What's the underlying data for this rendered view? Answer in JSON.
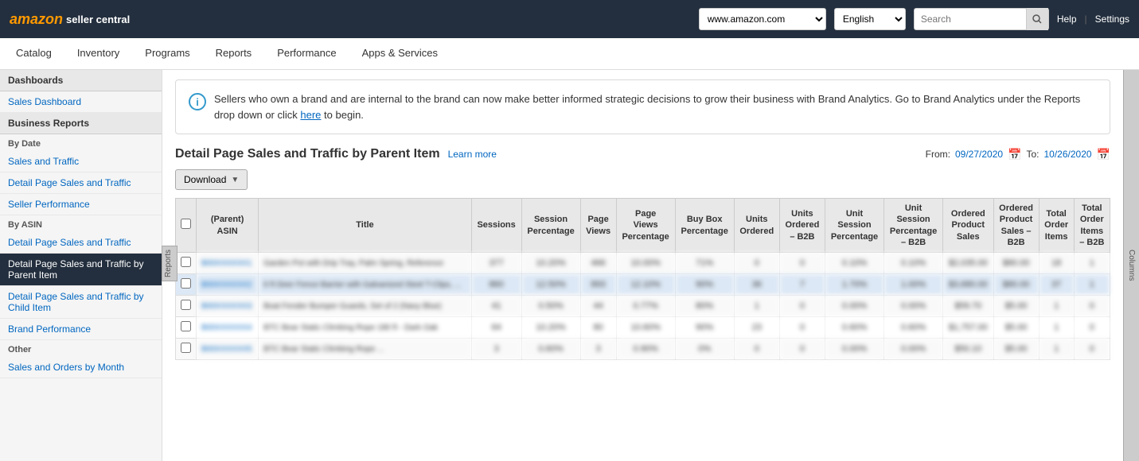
{
  "header": {
    "logo_brand": "amazon",
    "logo_service": "seller central",
    "domain": "www.amazon.com",
    "language": "English",
    "search_placeholder": "Search",
    "help_label": "Help",
    "settings_label": "Settings"
  },
  "navbar": {
    "items": [
      {
        "label": "Catalog"
      },
      {
        "label": "Inventory"
      },
      {
        "label": "Programs"
      },
      {
        "label": "Reports"
      },
      {
        "label": "Performance"
      },
      {
        "label": "Apps & Services"
      }
    ]
  },
  "sidebar": {
    "dashboards_header": "Dashboards",
    "sales_dashboard": "Sales Dashboard",
    "business_reports_header": "Business Reports",
    "by_date_label": "By Date",
    "items_by_date": [
      {
        "label": "Sales and Traffic"
      },
      {
        "label": "Detail Page Sales and Traffic"
      },
      {
        "label": "Seller Performance"
      }
    ],
    "by_asin_label": "By ASIN",
    "items_by_asin": [
      {
        "label": "Detail Page Sales and Traffic"
      },
      {
        "label": "Detail Page Sales and Traffic by Parent Item",
        "active": true
      },
      {
        "label": "Detail Page Sales and Traffic by Child Item"
      },
      {
        "label": "Brand Performance"
      }
    ],
    "other_label": "Other",
    "items_other": [
      {
        "label": "Sales and Orders by Month"
      }
    ],
    "reports_side_label": "Reports",
    "columns_side_label": "Columns"
  },
  "info_banner": {
    "text_before_link": "Sellers who own a brand and are internal to the brand can now make better informed strategic decisions to grow their business with Brand Analytics. Go to Brand Analytics under the Reports drop down or click ",
    "link_text": "here",
    "text_after_link": " to begin."
  },
  "table_section": {
    "title": "Detail Page Sales and Traffic by Parent Item",
    "learn_more": "Learn more",
    "from_label": "From:",
    "from_date": "09/27/2020",
    "to_label": "To:",
    "to_date": "10/26/2020",
    "download_label": "Download",
    "columns": [
      {
        "label": "(Parent)\nASIN",
        "key": "asin"
      },
      {
        "label": "Title",
        "key": "title"
      },
      {
        "label": "Sessions",
        "key": "sessions"
      },
      {
        "label": "Session\nPercentage",
        "key": "session_pct"
      },
      {
        "label": "Page\nViews",
        "key": "page_views"
      },
      {
        "label": "Page\nViews\nPercentage",
        "key": "page_views_pct"
      },
      {
        "label": "Buy Box\nPercentage",
        "key": "buy_box_pct"
      },
      {
        "label": "Units\nOrdered",
        "key": "units_ordered"
      },
      {
        "label": "Units\nOrdered\n– B2B",
        "key": "units_b2b"
      },
      {
        "label": "Unit\nSession\nPercentage",
        "key": "unit_session_pct"
      },
      {
        "label": "Unit\nSession\nPercentage\n– B2B",
        "key": "unit_session_b2b"
      },
      {
        "label": "Ordered\nProduct\nSales",
        "key": "ordered_product_sales"
      },
      {
        "label": "Ordered\nProduct\nSales –\nB2B",
        "key": "ordered_b2b"
      },
      {
        "label": "Total\nOrder\nItems",
        "key": "total_order_items"
      },
      {
        "label": "Total\nOrder\nItems\n– B2B",
        "key": "total_order_b2b"
      }
    ],
    "rows": [
      {
        "asin": "B00XXXXXX1",
        "title": "Garden Pot with Drip Tray, Palm Spring, Reference",
        "sessions": "377",
        "session_pct": "10.20%",
        "page_views": "466",
        "page_views_pct": "10.00%",
        "buy_box_pct": "71%",
        "units_ordered": "0",
        "units_b2b": "0",
        "unit_session_pct": "0.10%",
        "unit_session_b2b": "0.10%",
        "ordered_product_sales": "$2,035.00",
        "ordered_b2b": "$80.00",
        "total_order_items": "18",
        "total_order_b2b": "1"
      },
      {
        "asin": "B00XXXXXX2",
        "title": "6 ft Deer Fence Barrier with Galvanized Steel T-Clips, ...",
        "sessions": "860",
        "session_pct": "12.50%",
        "page_views": "893",
        "page_views_pct": "12.10%",
        "buy_box_pct": "90%",
        "units_ordered": "36",
        "units_b2b": "7",
        "unit_session_pct": "1.70%",
        "unit_session_b2b": "1.00%",
        "ordered_product_sales": "$3,680.00",
        "ordered_b2b": "$80.00",
        "total_order_items": "37",
        "total_order_b2b": "1"
      },
      {
        "asin": "B00XXXXXX3",
        "title": "Boat Fender Bumper Guards, Set of 2 (Navy Blue)",
        "sessions": "41",
        "session_pct": "0.50%",
        "page_views": "44",
        "page_views_pct": "0.77%",
        "buy_box_pct": "80%",
        "units_ordered": "1",
        "units_b2b": "0",
        "unit_session_pct": "0.00%",
        "unit_session_b2b": "0.00%",
        "ordered_product_sales": "$59.70",
        "ordered_b2b": "$5.00",
        "total_order_items": "1",
        "total_order_b2b": "0"
      },
      {
        "asin": "B00XXXXXX4",
        "title": "BTC Bear Static Climbing Rope 180 ft - Dark Oak",
        "sessions": "64",
        "session_pct": "10.20%",
        "page_views": "80",
        "page_views_pct": "10.60%",
        "buy_box_pct": "90%",
        "units_ordered": "23",
        "units_b2b": "0",
        "unit_session_pct": "0.60%",
        "unit_session_b2b": "0.60%",
        "ordered_product_sales": "$1,757.00",
        "ordered_b2b": "$5.00",
        "total_order_items": "1",
        "total_order_b2b": "0"
      },
      {
        "asin": "B00XXXXXX5",
        "title": "BTC Bear Static Climbing Rope ...",
        "sessions": "3",
        "session_pct": "0.60%",
        "page_views": "3",
        "page_views_pct": "0.90%",
        "buy_box_pct": "0%",
        "units_ordered": "0",
        "units_b2b": "0",
        "unit_session_pct": "0.00%",
        "unit_session_b2b": "0.00%",
        "ordered_product_sales": "$50.10",
        "ordered_b2b": "$5.00",
        "total_order_items": "1",
        "total_order_b2b": "0"
      }
    ]
  }
}
